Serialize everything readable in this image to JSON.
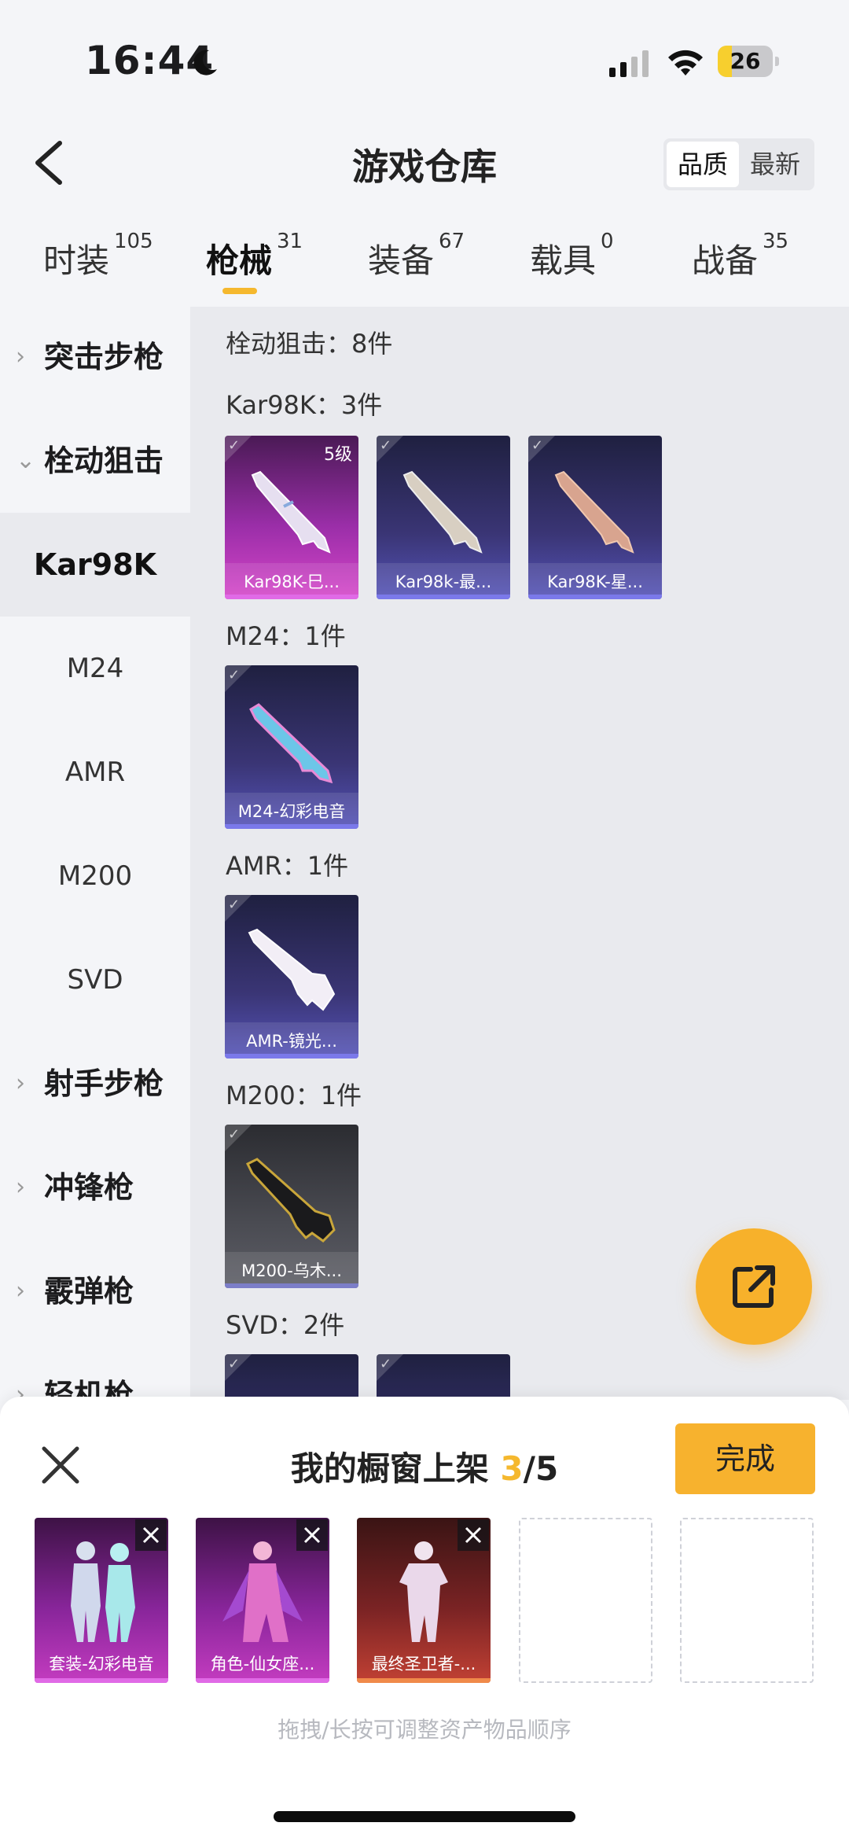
{
  "status_bar": {
    "time": "16:44",
    "battery": "26",
    "battery_level": 0.26
  },
  "header": {
    "title": "游戏仓库",
    "sort": [
      "品质",
      "最新"
    ],
    "sort_active": 0
  },
  "tabs": [
    {
      "label": "时装",
      "count": "105"
    },
    {
      "label": "枪械",
      "count": "31"
    },
    {
      "label": "装备",
      "count": "67"
    },
    {
      "label": "载具",
      "count": "0"
    },
    {
      "label": "战备",
      "count": "35"
    }
  ],
  "sidebar": {
    "items": [
      {
        "label": "突击步枪",
        "type": "category",
        "expanded": false
      },
      {
        "label": "栓动狙击",
        "type": "category",
        "expanded": true
      },
      {
        "label": "Kar98K",
        "type": "sub",
        "selected": true
      },
      {
        "label": "M24",
        "type": "sub"
      },
      {
        "label": "AMR",
        "type": "sub"
      },
      {
        "label": "M200",
        "type": "sub"
      },
      {
        "label": "SVD",
        "type": "sub"
      },
      {
        "label": "射手步枪",
        "type": "category",
        "expanded": false
      },
      {
        "label": "冲锋枪",
        "type": "category",
        "expanded": false
      },
      {
        "label": "霰弹枪",
        "type": "category",
        "expanded": false
      },
      {
        "label": "轻机枪",
        "type": "category",
        "expanded": false
      }
    ]
  },
  "content": {
    "group_title": "栓动狙击：8件",
    "sections": [
      {
        "label": "Kar98K：3件",
        "items": [
          {
            "name": "Kar98K-巳...",
            "level": "5级",
            "style": "pink"
          },
          {
            "name": "Kar98k-最...",
            "style": "purple"
          },
          {
            "name": "Kar98K-星...",
            "style": "purple"
          }
        ]
      },
      {
        "label": "M24：1件",
        "items": [
          {
            "name": "M24-幻彩电音",
            "style": "purple"
          }
        ]
      },
      {
        "label": "AMR：1件",
        "items": [
          {
            "name": "AMR-镜光...",
            "style": "purple"
          }
        ]
      },
      {
        "label": "M200：1件",
        "items": [
          {
            "name": "M200-乌木...",
            "style": "gray"
          }
        ]
      },
      {
        "label": "SVD：2件",
        "items": [
          {
            "name": "",
            "style": "purple"
          },
          {
            "name": "",
            "style": "purple"
          }
        ]
      }
    ]
  },
  "showcase": {
    "title": "我的橱窗上架",
    "count": "3",
    "total": "/5",
    "done_label": "完成",
    "slots": [
      {
        "name": "套装-幻彩电音",
        "style": "pink"
      },
      {
        "name": "角色-仙女座...",
        "style": "pink"
      },
      {
        "name": "最终圣卫者-...",
        "style": "red"
      },
      {
        "name": "",
        "style": "empty"
      },
      {
        "name": "",
        "style": "empty"
      }
    ],
    "hint": "拖拽/长按可调整资产物品顺序"
  },
  "icons": {
    "back": "chevron-left-icon",
    "fab": "share-export-icon",
    "close": "close-icon",
    "moon": "moon-icon",
    "signal": "cellular-signal-icon",
    "wifi": "wifi-icon"
  },
  "colors": {
    "accent": "#f5b82e",
    "card_purple": "#5553b8",
    "card_pink": "#d646c9"
  }
}
